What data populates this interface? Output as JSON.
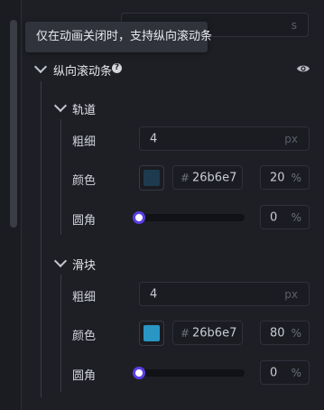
{
  "tooltip": {
    "text": "仅在动画关闭时，支持纵向滚动条"
  },
  "top_input": {
    "unit": "s"
  },
  "vertical_scrollbar": {
    "title": "纵向滚动条",
    "help_icon": "question-circle-icon",
    "help_glyph": "?",
    "visibility_icon": "eye-icon"
  },
  "track": {
    "title": "轨道",
    "thickness": {
      "label": "粗细",
      "value": "4",
      "unit": "px"
    },
    "color": {
      "label": "颜色",
      "swatch": "#1e3a4f",
      "hash": "#",
      "hex": "26b6e7",
      "opacity": "20",
      "percent": "%"
    },
    "radius": {
      "label": "圆角",
      "slider_value": 0,
      "value": "0",
      "percent": "%"
    }
  },
  "thumb": {
    "title": "滑块",
    "thickness": {
      "label": "粗细",
      "value": "4",
      "unit": "px"
    },
    "color": {
      "label": "颜色",
      "swatch": "#2996c4",
      "hash": "#",
      "hex": "26b6e7",
      "opacity": "80",
      "percent": "%"
    },
    "radius": {
      "label": "圆角",
      "slider_value": 0,
      "value": "0",
      "percent": "%"
    }
  },
  "colors": {
    "slider_accent": "#5b3ee6",
    "background": "#1d1f25"
  }
}
